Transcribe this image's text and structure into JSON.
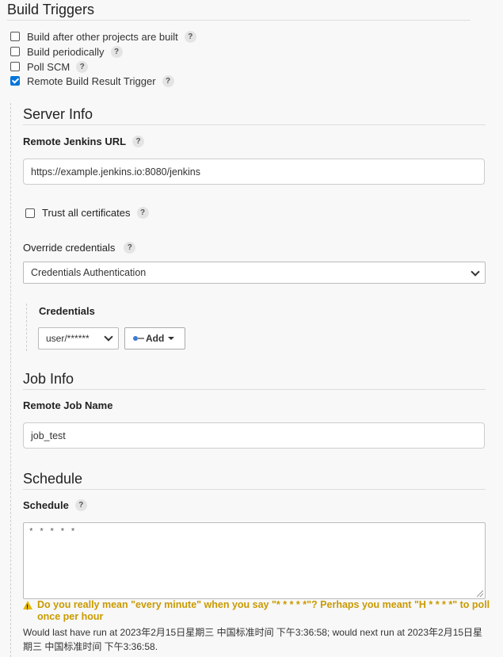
{
  "build_triggers": {
    "title": "Build Triggers",
    "items": [
      {
        "label": "Build after other projects are built",
        "checked": false
      },
      {
        "label": "Build periodically",
        "checked": false
      },
      {
        "label": "Poll SCM",
        "checked": false
      },
      {
        "label": "Remote Build Result Trigger",
        "checked": true
      }
    ]
  },
  "help_glyph": "?",
  "server_info": {
    "title": "Server Info",
    "remote_url_label": "Remote Jenkins URL",
    "remote_url_value": "https://example.jenkins.io:8080/jenkins",
    "trust_certs_label": "Trust all certificates",
    "trust_certs_checked": false,
    "override_label": "Override credentials",
    "override_value": "Credentials Authentication",
    "credentials_label": "Credentials",
    "credentials_value": "user/******",
    "add_button_label": "Add"
  },
  "job_info": {
    "title": "Job Info",
    "job_name_label": "Remote Job Name",
    "job_name_value": "job_test"
  },
  "schedule": {
    "title": "Schedule",
    "label": "Schedule",
    "value": "* * * * *",
    "warning": "Do you really mean \"every minute\" when you say \"* * * * *\"? Perhaps you meant \"H * * * *\" to poll once per hour",
    "info": "Would last have run at 2023年2月15日星期三 中国标准时间 下午3:36:58; would next run at 2023年2月15日星期三 中国标准时间 下午3:36:58."
  },
  "colors": {
    "accent": "#0074d9",
    "warning": "#c99a00",
    "background": "#f8f8f8"
  }
}
